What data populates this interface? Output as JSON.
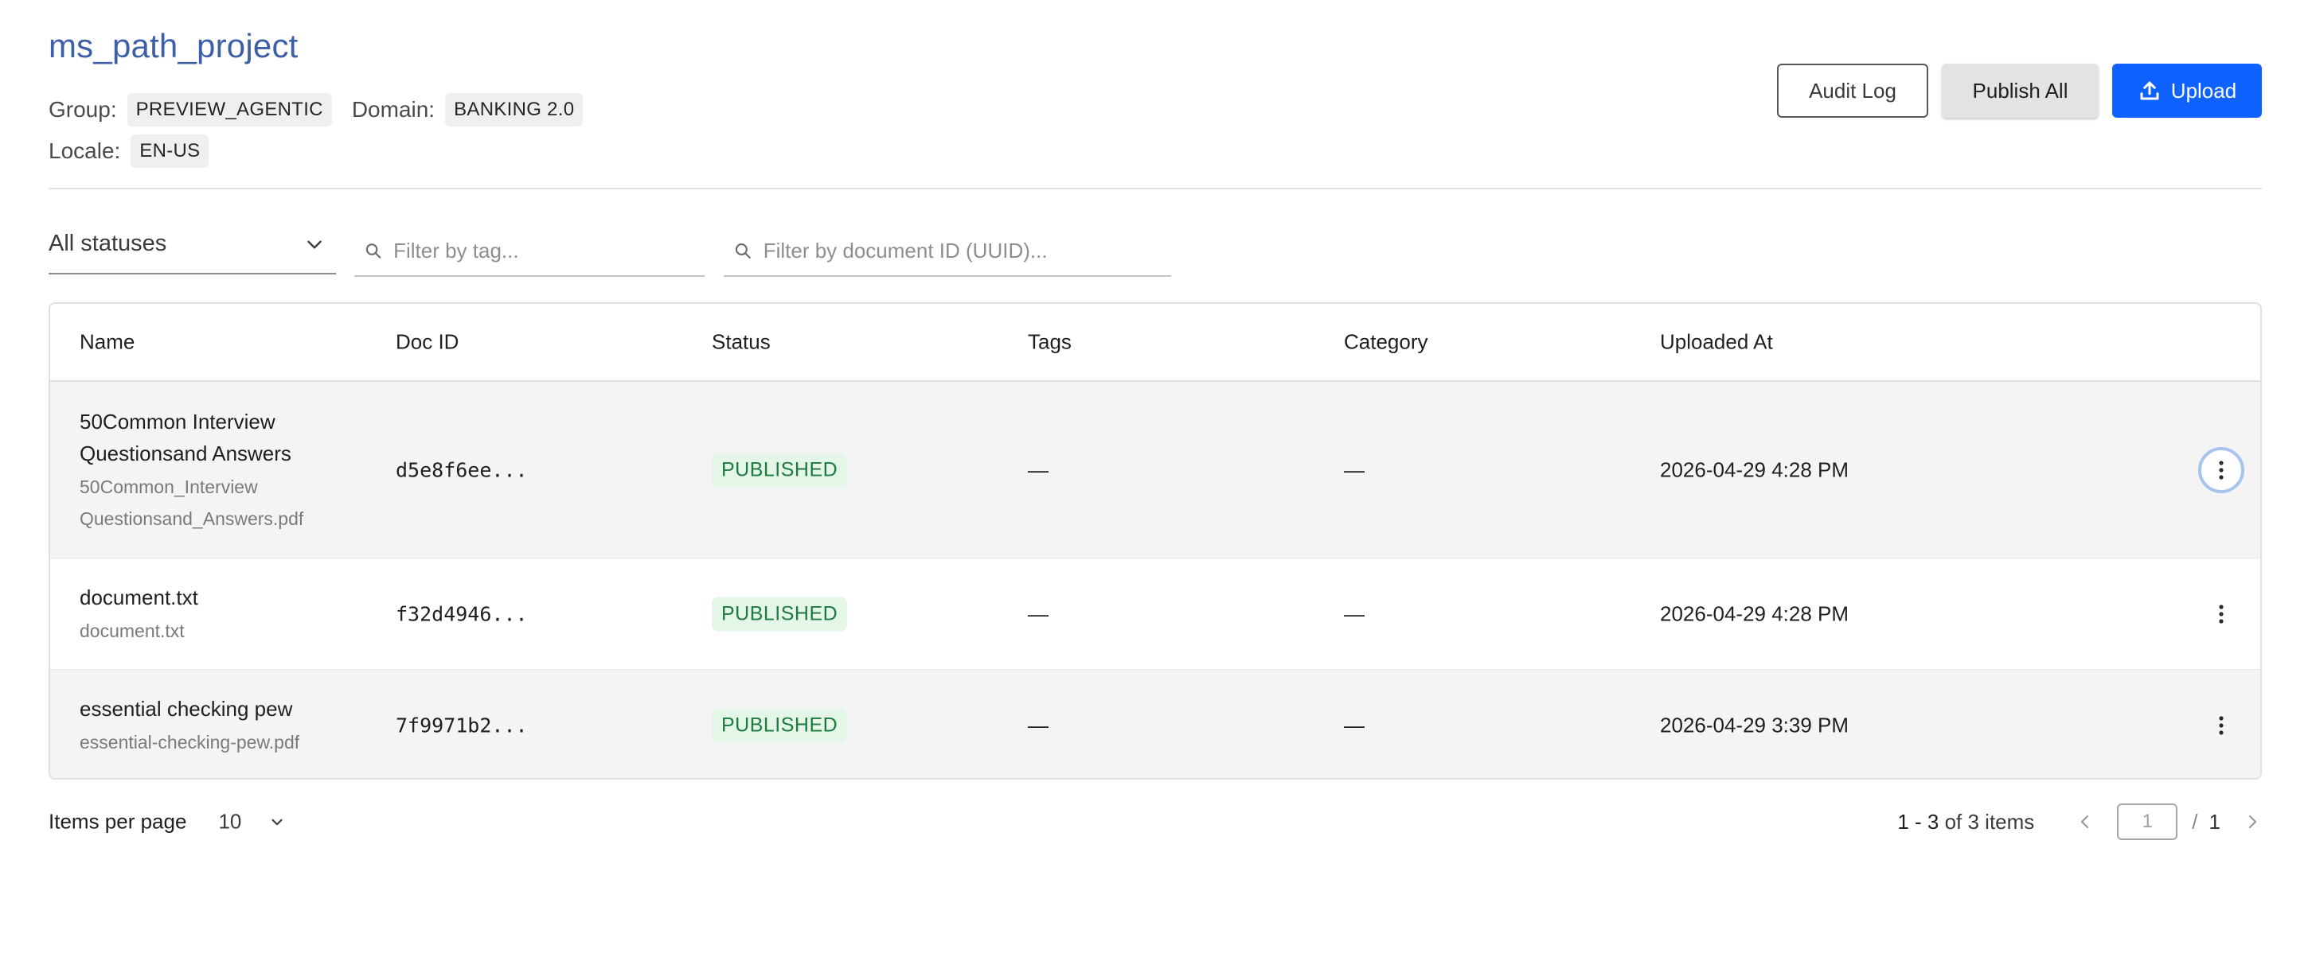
{
  "project": {
    "title": "ms_path_project",
    "group_label": "Group:",
    "group_value": "PREVIEW_AGENTIC",
    "domain_label": "Domain:",
    "domain_value": "BANKING 2.0",
    "locale_label": "Locale:",
    "locale_value": "EN-US"
  },
  "actions": {
    "audit_log": "Audit Log",
    "publish_all": "Publish All",
    "upload": "Upload"
  },
  "filters": {
    "status_selected": "All statuses",
    "tag_placeholder": "Filter by tag...",
    "doc_placeholder": "Filter by document ID (UUID)..."
  },
  "table": {
    "columns": [
      "Name",
      "Doc ID",
      "Status",
      "Tags",
      "Category",
      "Uploaded At"
    ],
    "rows": [
      {
        "name_line1": "50Common Interview",
        "name_line2": "Questionsand Answers",
        "file_line1": "50Common_Interview",
        "file_line2": "Questionsand_Answers.pdf",
        "doc_id": "d5e8f6ee...",
        "status": "PUBLISHED",
        "tags": "—",
        "category": "—",
        "uploaded_at": "2026-04-29 4:28 PM"
      },
      {
        "name_line1": "document.txt",
        "file_line1": "document.txt",
        "doc_id": "f32d4946...",
        "status": "PUBLISHED",
        "tags": "—",
        "category": "—",
        "uploaded_at": "2026-04-29 4:28 PM"
      },
      {
        "name_line1": "essential checking pew",
        "file_line1": "essential-checking-pew.pdf",
        "doc_id": "7f9971b2...",
        "status": "PUBLISHED",
        "tags": "—",
        "category": "—",
        "uploaded_at": "2026-04-29 3:39 PM"
      }
    ]
  },
  "pagination": {
    "items_per_page_label": "Items per page",
    "items_per_page_value": "10",
    "range": "1 - 3",
    "range_suffix": "of 3 items",
    "current_page_placeholder": "1",
    "slash": "/",
    "total_pages": "1"
  },
  "colors": {
    "title": "#3d5fa8",
    "primary": "#0f62fe",
    "published_bg": "#e3f6e8",
    "published_text": "#1f7a3d"
  }
}
